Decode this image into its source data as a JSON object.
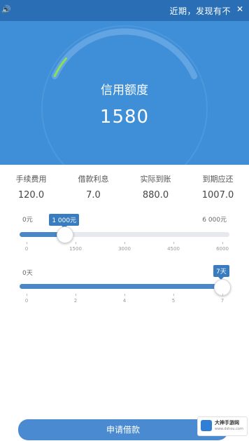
{
  "notice": {
    "speaker_icon": "speaker-icon",
    "text": "近期，发现有不",
    "close_icon": "close-icon"
  },
  "credit": {
    "title": "信用额度",
    "amount": "1580",
    "gauge_progress": 0.12
  },
  "stats": [
    {
      "label": "手续费用",
      "value": "120.0"
    },
    {
      "label": "借款利息",
      "value": "7.0"
    },
    {
      "label": "实际到账",
      "value": "880.0"
    },
    {
      "label": "到期应还",
      "value": "1007.0"
    }
  ],
  "amount_slider": {
    "min_label": "0元",
    "max_label": "6 000元",
    "selected_label": "1 000元",
    "value_fraction": 0.19,
    "ticks": [
      "0",
      "1500",
      "3000",
      "4500",
      "6000"
    ]
  },
  "days_slider": {
    "min_label": "0天",
    "selected_label": "7天",
    "value_fraction": 1.0,
    "ticks": [
      "0",
      "2",
      "4",
      "5",
      "7"
    ]
  },
  "apply_button": "申请借款",
  "watermark": {
    "line1": "大神手游网",
    "line2": "www.dshou.com"
  }
}
